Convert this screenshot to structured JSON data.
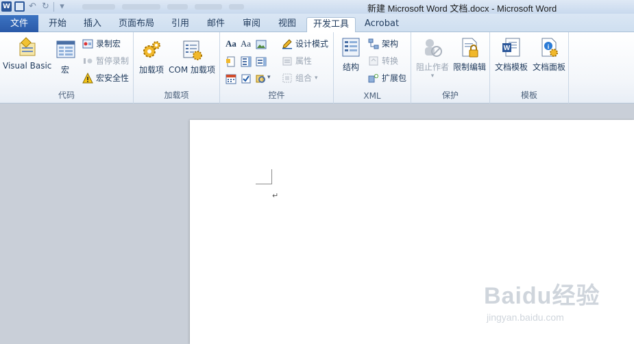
{
  "window": {
    "title": "新建 Microsoft Word 文档.docx  -  Microsoft Word"
  },
  "qat": {
    "app_icon_letter": "W",
    "items": [
      "save-icon",
      "undo-icon",
      "redo-icon",
      "customize-icon"
    ]
  },
  "tabs": [
    {
      "label": "文件"
    },
    {
      "label": "开始"
    },
    {
      "label": "插入"
    },
    {
      "label": "页面布局"
    },
    {
      "label": "引用"
    },
    {
      "label": "邮件"
    },
    {
      "label": "审阅"
    },
    {
      "label": "视图"
    },
    {
      "label": "开发工具"
    },
    {
      "label": "Acrobat"
    }
  ],
  "active_tab": "开发工具",
  "ribbon": {
    "code": {
      "label": "代码",
      "visual_basic": "Visual Basic",
      "macros": "宏",
      "record_macro": "录制宏",
      "pause_recording": "暂停录制",
      "macro_security": "宏安全性"
    },
    "addins": {
      "label": "加载项",
      "addins": "加载项",
      "com_addins": "COM 加载项"
    },
    "controls": {
      "label": "控件",
      "design_mode": "设计模式",
      "properties": "属性",
      "group": "组合",
      "rich_text_glyph": "Aa",
      "plain_text_glyph": "Aa"
    },
    "xml": {
      "label": "XML",
      "structure": "结构",
      "schema": "架构",
      "transform": "转换",
      "expansion_packs": "扩展包"
    },
    "protect": {
      "label": "保护",
      "block_authors": "阻止作者",
      "restrict_editing": "限制编辑"
    },
    "templates": {
      "label": "模板",
      "document_template": "文档模板",
      "document_panel": "文档面板"
    }
  },
  "document": {
    "paragraph_mark": "↵"
  },
  "watermark": {
    "main": "Baidu经验",
    "url": "jingyan.baidu.com"
  },
  "colors": {
    "file_tab": "#2a5aa8",
    "ribbon_bg": "#ffffff",
    "workspace_bg": "#c9cfd8"
  }
}
